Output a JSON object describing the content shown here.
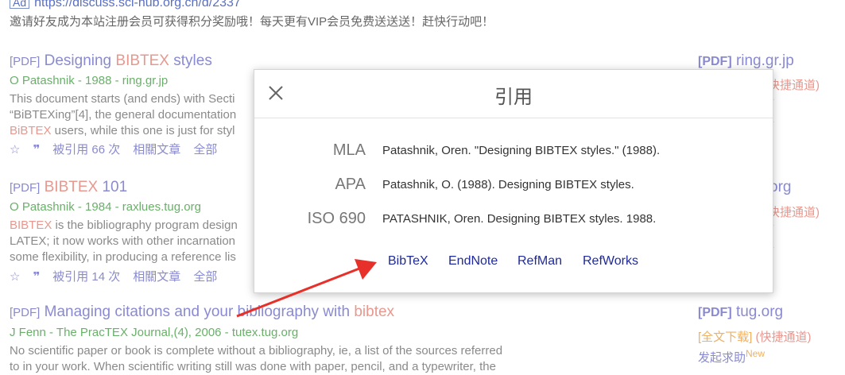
{
  "ad": {
    "badge": "Ad",
    "url": "https://discuss.sci-hub.org.cn/d/2337",
    "notice": "邀请好友成为本站注册会员可获得积分奖励哦！每天更有VIP会员免费送送送！赶快行动吧！"
  },
  "results": [
    {
      "tag": "[PDF]",
      "title_pre": "Designing ",
      "title_hl": "BIBTEX",
      "title_post": " styles",
      "meta": "O Patashnik - 1988 - ring.gr.jp",
      "snippet": [
        {
          "pre": "This document starts (and ends) with Secti",
          "hl": "",
          "post": ""
        },
        {
          "pre": "“BiBTEXing”[4], the general documentation",
          "hl": "",
          "post": ""
        },
        {
          "pre": "",
          "hl": "BiBTEX",
          "post": " users, while this one is just for styl"
        }
      ],
      "actions": {
        "cited": "被引用 66 次",
        "related": "相關文章",
        "all": "全部"
      }
    },
    {
      "tag": "[PDF]",
      "title_pre": "",
      "title_hl": "BIBTEX",
      "title_post": " 101",
      "meta": "O Patashnik - 1984 - raxlues.tug.org",
      "snippet": [
        {
          "pre": "",
          "hl": "BIBTEX",
          "post": " is the bibliography program design"
        },
        {
          "pre": "LATEX; it now works with other incarnation",
          "hl": "",
          "post": ""
        },
        {
          "pre": "some flexibility, in producing a reference lis",
          "hl": "",
          "post": ""
        }
      ],
      "actions": {
        "cited": "被引用 14 次",
        "related": "相關文章",
        "all": "全部"
      }
    },
    {
      "tag": "[PDF]",
      "title_pre": "Managing citations and your bibliography with ",
      "title_hl": "bibtex",
      "title_post": "",
      "meta": "J Fenn - The PracTEX Journal,(4), 2006 - tutex.tug.org",
      "snippet": [
        {
          "pre": "No scientific paper or book is complete without a bibliography, ie, a list of the sources referred",
          "hl": "",
          "post": ""
        },
        {
          "pre": "to in your work. When scientific writing still was done with paper, pencil, and a typewriter, the",
          "hl": "",
          "post": ""
        }
      ]
    }
  ],
  "sidebar": {
    "items": [
      {
        "tag": "[PDF]",
        "domain": "ring.gr.jp",
        "link": "快捷通道)"
      },
      {
        "tag": "",
        "domain": "org",
        "link": "快捷通道)"
      },
      {
        "tag": "[PDF]",
        "domain": "tug.org",
        "fulltext": "[全文下载]",
        "link": "(快捷通道)",
        "help": "发起求助",
        "help_badge": "New"
      }
    ]
  },
  "modal": {
    "title": "引用",
    "citations": [
      {
        "label": "MLA",
        "text": "Patashnik, Oren. \"Designing BIBTEX styles.\" (1988)."
      },
      {
        "label": "APA",
        "text": "Patashnik, O. (1988). Designing BIBTEX styles."
      },
      {
        "label": "ISO 690",
        "text": "PATASHNIK, Oren. Designing BIBTEX styles. 1988."
      }
    ],
    "exports": [
      "BibTeX",
      "EndNote",
      "RefMan",
      "RefWorks"
    ]
  },
  "colors": {
    "title_link": "#8a8ad0",
    "highlight": "#e8988f",
    "meta_green": "#6ab06a",
    "export_link": "#1f2a9a",
    "arrow": "#e8302a"
  }
}
